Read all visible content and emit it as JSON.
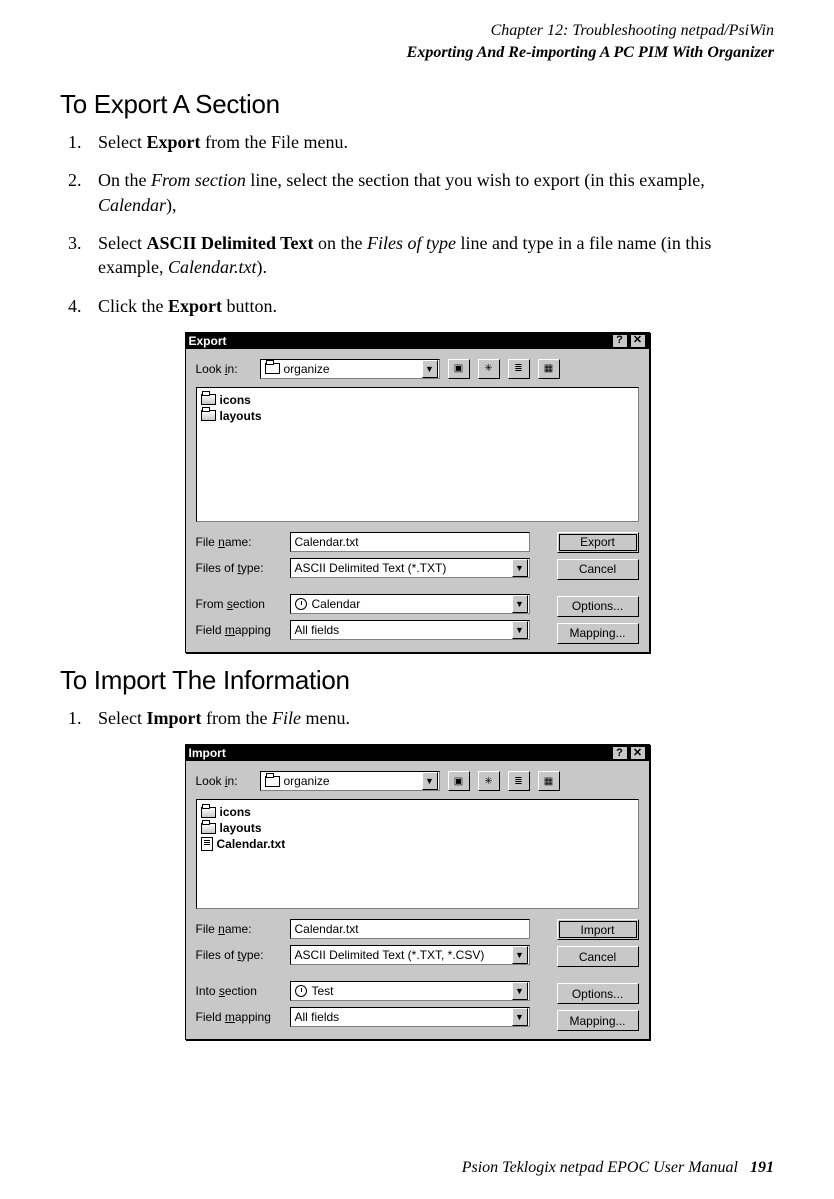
{
  "header": {
    "line1": "Chapter 12:  Troubleshooting netpad/PsiWin",
    "line2": "Exporting And Re-importing A PC PIM With Organizer"
  },
  "sectionA": {
    "title": "To Export A Section",
    "steps": {
      "s1_a": "Select ",
      "s1_b": "Export",
      "s1_c": " from the File menu.",
      "s2_a": "On the ",
      "s2_b": "From section",
      "s2_c": " line, select the section that you wish to export (in this example, ",
      "s2_d": "Calendar",
      "s2_e": "),",
      "s3_a": "Select ",
      "s3_b": "ASCII Delimited Text",
      "s3_c": " on the ",
      "s3_d": "Files of type",
      "s3_e": " line and type in a file name (in this example, ",
      "s3_f": "Calendar.txt",
      "s3_g": ").",
      "s4_a": "Click the ",
      "s4_b": "Export",
      "s4_c": " button."
    }
  },
  "sectionB": {
    "title": "To Import The Information",
    "steps": {
      "s1_a": "Select ",
      "s1_b": "Import",
      "s1_c": " from the ",
      "s1_d": "File",
      "s1_e": " menu."
    }
  },
  "dialogExport": {
    "title": "Export",
    "help": "?",
    "close": "✕",
    "lookin_label": "Look in:",
    "lookin_value": "organize",
    "file_icons": "icons",
    "file_layouts": "layouts",
    "filename_label": "File name:",
    "filename_value": "Calendar.txt",
    "filetype_label": "Files of type:",
    "filetype_value": "ASCII Delimited Text (*.TXT)",
    "from_label": "From section",
    "from_value": "Calendar",
    "fieldmap_label": "Field mapping",
    "fieldmap_value": "All fields",
    "btn_primary": "Export",
    "btn_cancel": "Cancel",
    "btn_options": "Options...",
    "btn_mapping": "Mapping..."
  },
  "dialogImport": {
    "title": "Import",
    "help": "?",
    "close": "✕",
    "lookin_label": "Look in:",
    "lookin_value": "organize",
    "file_icons": "icons",
    "file_layouts": "layouts",
    "file_calendar": "Calendar.txt",
    "filename_label": "File name:",
    "filename_value": "Calendar.txt",
    "filetype_label": "Files of type:",
    "filetype_value": "ASCII Delimited Text (*.TXT, *.CSV)",
    "into_label": "Into section",
    "into_value": "Test",
    "fieldmap_label": "Field mapping",
    "fieldmap_value": "All fields",
    "btn_primary": "Import",
    "btn_cancel": "Cancel",
    "btn_options": "Options...",
    "btn_mapping": "Mapping..."
  },
  "footer": {
    "text": "Psion Teklogix netpad EPOC User Manual",
    "page": "191"
  }
}
